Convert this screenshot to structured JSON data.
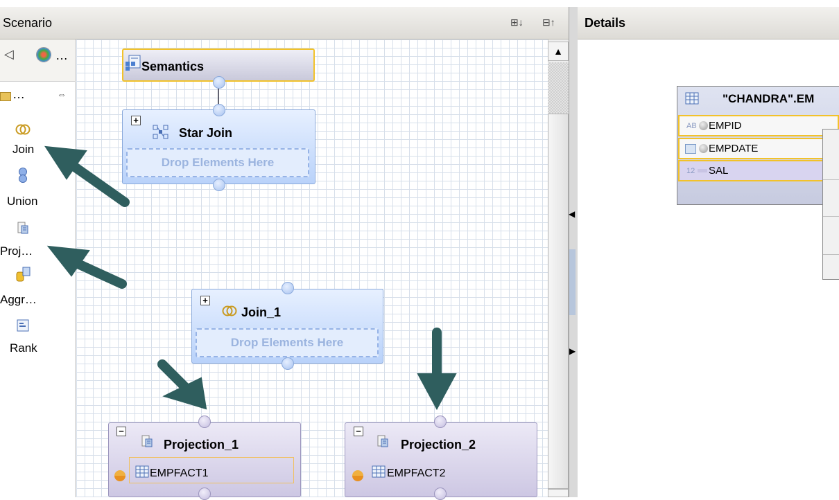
{
  "scenario": {
    "title": "Scenario",
    "expand_label": "⊞↓",
    "collapse_label": "⊟↑"
  },
  "palette": {
    "nav_back": "◁",
    "overflow1": "…",
    "overflow2": "…",
    "items": [
      {
        "label": "Join"
      },
      {
        "label": "Union"
      },
      {
        "label": "Proj…"
      },
      {
        "label": "Aggr…"
      },
      {
        "label": "Rank"
      }
    ]
  },
  "nodes": {
    "semantics": {
      "title": "Semantics"
    },
    "star_join": {
      "title": "Star Join",
      "drop_text": "Drop Elements Here"
    },
    "join_1": {
      "title": "Join_1",
      "drop_text": "Drop Elements Here"
    },
    "projection_1": {
      "title": "Projection_1",
      "table": "EMPFACT1"
    },
    "projection_2": {
      "title": "Projection_2",
      "table": "EMPFACT2"
    }
  },
  "details": {
    "title": "Details",
    "table_title": "\"CHANDRA\".EM",
    "columns": [
      {
        "type": "AB",
        "name": "EMPID"
      },
      {
        "type": "",
        "name": "EMPDATE"
      },
      {
        "type": "12",
        "name": "SAL"
      }
    ]
  },
  "colors": {
    "arrow": "#2f5e5e",
    "highlight": "#f2c22a",
    "node_blue": "#b9d2fa",
    "node_purple": "#cdc7e3"
  }
}
